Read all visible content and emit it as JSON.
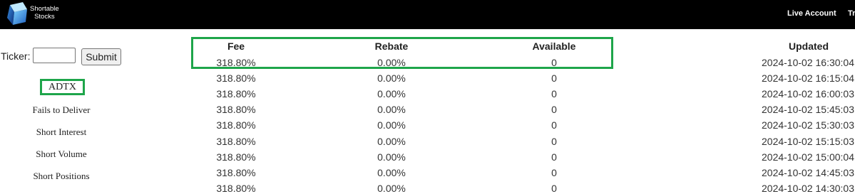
{
  "brand": {
    "line1": "Shortable",
    "line2": "Stocks"
  },
  "nav": {
    "live_account": "Live Account",
    "truncated": "Tr"
  },
  "sidebar": {
    "ticker_label": "Ticker:",
    "ticker_value": "",
    "submit_label": "Submit",
    "symbol": "ADTX",
    "links": [
      "Fails to Deliver",
      "Short Interest",
      "Short Volume",
      "Short Positions"
    ]
  },
  "table": {
    "headers": {
      "fee": "Fee",
      "rebate": "Rebate",
      "available": "Available",
      "updated": "Updated"
    },
    "rows": [
      {
        "fee": "318.80%",
        "rebate": "0.00%",
        "available": "0",
        "updated": "2024-10-02 16:30:04"
      },
      {
        "fee": "318.80%",
        "rebate": "0.00%",
        "available": "0",
        "updated": "2024-10-02 16:15:04"
      },
      {
        "fee": "318.80%",
        "rebate": "0.00%",
        "available": "0",
        "updated": "2024-10-02 16:00:03"
      },
      {
        "fee": "318.80%",
        "rebate": "0.00%",
        "available": "0",
        "updated": "2024-10-02 15:45:03"
      },
      {
        "fee": "318.80%",
        "rebate": "0.00%",
        "available": "0",
        "updated": "2024-10-02 15:30:03"
      },
      {
        "fee": "318.80%",
        "rebate": "0.00%",
        "available": "0",
        "updated": "2024-10-02 15:15:03"
      },
      {
        "fee": "318.80%",
        "rebate": "0.00%",
        "available": "0",
        "updated": "2024-10-02 15:00:04"
      },
      {
        "fee": "318.80%",
        "rebate": "0.00%",
        "available": "0",
        "updated": "2024-10-02 14:45:03"
      },
      {
        "fee": "318.80%",
        "rebate": "0.00%",
        "available": "0",
        "updated": "2024-10-02 14:30:03"
      }
    ]
  },
  "colors": {
    "highlight": "#1ea54a",
    "topbar": "#000000"
  }
}
